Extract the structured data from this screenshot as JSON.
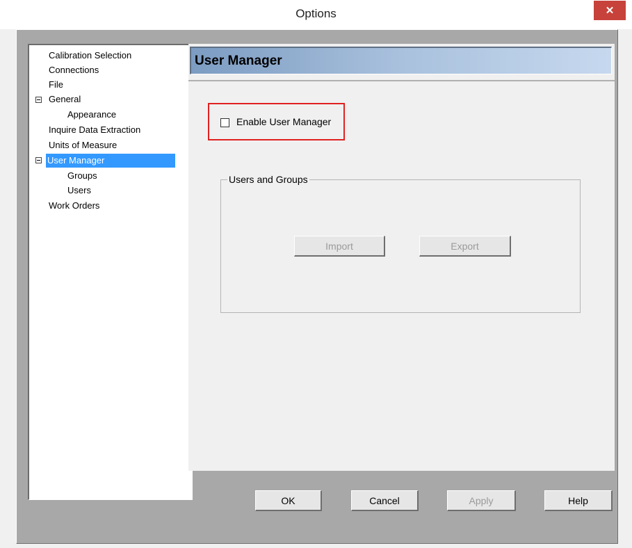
{
  "window": {
    "title": "Options",
    "close_icon": "✕"
  },
  "tree": {
    "items": [
      {
        "label": "Calibration Selection",
        "expander": false,
        "selected": false
      },
      {
        "label": "Connections",
        "expander": false,
        "selected": false
      },
      {
        "label": "File",
        "expander": false,
        "selected": false
      },
      {
        "label": "General",
        "expander": true,
        "selected": false
      },
      {
        "label": "Appearance",
        "expander": false,
        "selected": false
      },
      {
        "label": "Inquire Data Extraction",
        "expander": false,
        "selected": false
      },
      {
        "label": "Units of Measure",
        "expander": false,
        "selected": false
      },
      {
        "label": "User Manager",
        "expander": true,
        "selected": true
      },
      {
        "label": "Groups",
        "expander": false,
        "selected": false
      },
      {
        "label": "Users",
        "expander": false,
        "selected": false
      },
      {
        "label": "Work Orders",
        "expander": false,
        "selected": false
      }
    ]
  },
  "panel": {
    "header": "User Manager",
    "enable_checkbox": {
      "label": "Enable User Manager",
      "checked": false
    },
    "group": {
      "legend": "Users and Groups",
      "import_label": "Import",
      "export_label": "Export"
    }
  },
  "buttons": {
    "ok": "OK",
    "cancel": "Cancel",
    "apply": "Apply",
    "help": "Help"
  },
  "colors": {
    "selection": "#3399ff",
    "highlight_border": "#e02020",
    "close_button": "#c7423a"
  }
}
